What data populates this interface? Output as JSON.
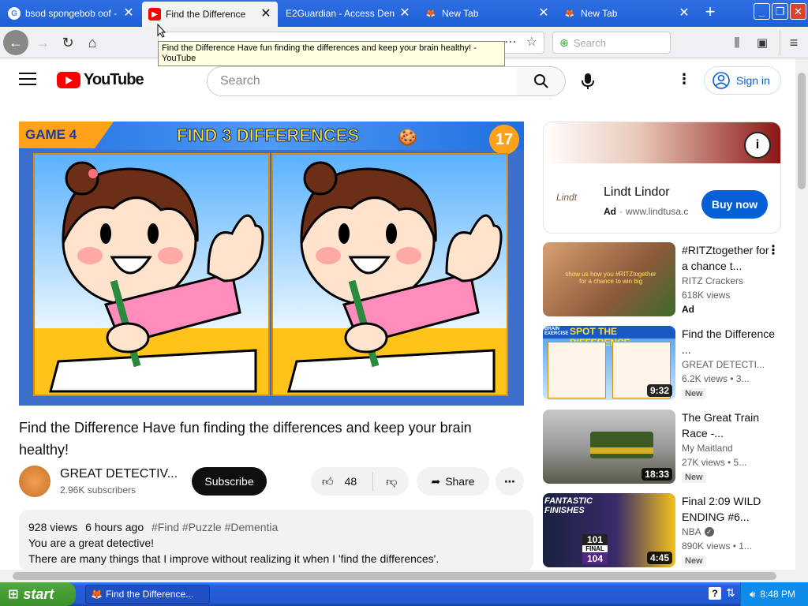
{
  "browser": {
    "tabs": [
      {
        "title": "bsod spongebob oof - G",
        "favicon": "google-g-icon"
      },
      {
        "title": "Find the Difference",
        "favicon": "youtube-icon"
      },
      {
        "title": "E2Guardian - Access Denied",
        "favicon": "none"
      },
      {
        "title": "New Tab",
        "favicon": "firefox-icon"
      },
      {
        "title": "New Tab",
        "favicon": "firefox-icon"
      }
    ],
    "search_placeholder": "Search",
    "tooltip": "Find the Difference Have fun finding the differences and keep your brain healthy! - YouTube"
  },
  "youtube": {
    "logo_text": "YouTube",
    "search_placeholder": "Search",
    "signin_label": "Sign in"
  },
  "video": {
    "title": "Find the Difference Have fun finding the differences and keep your brain healthy!",
    "thumbnail": {
      "game_label": "GAME 4",
      "headline": "FIND 3 DIFFERENCES",
      "number": "17"
    },
    "channel_name": "GREAT DETECTIV...",
    "subscribers": "2.96K subscribers",
    "subscribe_label": "Subscribe",
    "likes": "48",
    "share_label": "Share",
    "description": {
      "views": "928 views",
      "age": "6 hours ago",
      "hashtags": "#Find #Puzzle #Dementia",
      "line1": "You are a great detective!",
      "line2": "There are many things that I improve without realizing it when I 'find the differences'."
    }
  },
  "ad": {
    "brand": "Lindt Lindor",
    "ad_label": "Ad",
    "url": "www.lindtusa.c",
    "button": "Buy now",
    "logo_text": "Lindt"
  },
  "recommendations": [
    {
      "title": "#RITZtogether for a chance t...",
      "channel": "RITZ Crackers",
      "meta": "618K views",
      "badge": "Ad",
      "duration": "",
      "thumb_caption": "show us how you #RITZtogether for a chance to win big"
    },
    {
      "title": "Find the Difference ...",
      "channel": "GREAT DETECTI...",
      "meta": "6.2K views • 3...",
      "badge": "New",
      "duration": "9:32",
      "thumb_caption": "SPOT THE DIFFERENCE",
      "thumb_tag": "BRAIN EXERCISE"
    },
    {
      "title": "The Great Train Race -...",
      "channel": "My Maitland",
      "meta": "27K views • 5...",
      "badge": "New",
      "duration": "18:33"
    },
    {
      "title": "Final 2:09 WILD ENDING #6...",
      "channel": "NBA",
      "meta": "890K views • 1...",
      "badge": "New",
      "duration": "4:45",
      "thumb_caption": "FANTASTIC FINISHES",
      "score_top": "101",
      "score_bottom": "104",
      "score_label": "FINAL"
    }
  ],
  "taskbar": {
    "start_label": "start",
    "task_item": "Find the Difference...",
    "time": "8:48 PM"
  },
  "colors": {
    "youtube_red": "#ff0000",
    "link_blue": "#065fd4",
    "xp_blue": "#245edb",
    "xp_green": "#3c8f2c"
  }
}
